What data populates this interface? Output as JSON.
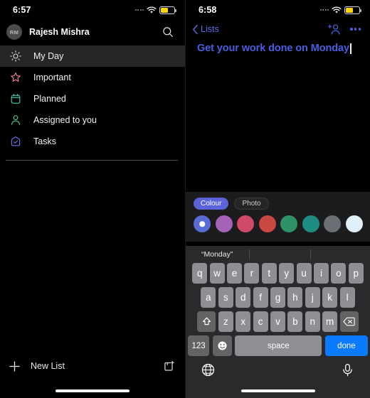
{
  "left": {
    "status": {
      "time": "6:57",
      "battery_color": "#ffd60a",
      "wifi_icon": "wifi-icon"
    },
    "account": {
      "initials": "RM",
      "name": "Rajesh Mishra",
      "search_icon": "search-icon"
    },
    "nav_items": [
      {
        "label": "My Day",
        "icon": "sun-icon",
        "color": "#e6e6e6",
        "selected": true
      },
      {
        "label": "Important",
        "icon": "star-icon",
        "color": "#f08098",
        "selected": false
      },
      {
        "label": "Planned",
        "icon": "calendar-icon",
        "color": "#4ec9b0",
        "selected": false
      },
      {
        "label": "Assigned to you",
        "icon": "person-icon",
        "color": "#4ec98a",
        "selected": false
      },
      {
        "label": "Tasks",
        "icon": "tasks-home-icon",
        "color": "#6a72e8",
        "selected": false
      }
    ],
    "footer": {
      "new_list_label": "New List",
      "plus_icon": "plus-icon",
      "new_group_icon": "new-group-icon"
    }
  },
  "right": {
    "status": {
      "time": "6:58",
      "battery_color": "#ffd60a",
      "wifi_icon": "wifi-icon"
    },
    "navbar": {
      "back_label": "Lists",
      "back_icon": "chevron-left-icon",
      "add_person_icon": "add-person-icon",
      "more_icon": "more-options-icon",
      "accent": "#4a5fe0"
    },
    "list_title": {
      "value": "Get your work done on Monday",
      "color": "#4a5fe0"
    },
    "picker": {
      "tabs": [
        {
          "label": "Colour",
          "active": true
        },
        {
          "label": "Photo",
          "active": false
        }
      ],
      "swatches": [
        {
          "name": "blue",
          "hex": "#5b6bd6",
          "selected": true
        },
        {
          "name": "purple",
          "hex": "#a563b8",
          "selected": false
        },
        {
          "name": "pink",
          "hex": "#cf4a68",
          "selected": false
        },
        {
          "name": "red",
          "hex": "#c9483f",
          "selected": false
        },
        {
          "name": "green",
          "hex": "#2e9266",
          "selected": false
        },
        {
          "name": "teal",
          "hex": "#1f8c84",
          "selected": false
        },
        {
          "name": "grey",
          "hex": "#6b7077",
          "selected": false
        },
        {
          "name": "light-blue",
          "hex": "#dff0fb",
          "selected": false
        }
      ]
    },
    "keyboard": {
      "prediction": "“Monday”",
      "row1": [
        "q",
        "w",
        "e",
        "r",
        "t",
        "y",
        "u",
        "i",
        "o",
        "p"
      ],
      "row2": [
        "a",
        "s",
        "d",
        "f",
        "g",
        "h",
        "j",
        "k",
        "l"
      ],
      "row3": [
        "z",
        "x",
        "c",
        "v",
        "b",
        "n",
        "m"
      ],
      "shift_icon": "shift-icon",
      "backspace_icon": "backspace-icon",
      "numbers_label": "123",
      "emoji_icon": "emoji-icon",
      "space_label": "space",
      "done_label": "done",
      "done_color": "#0a7bff",
      "globe_icon": "globe-icon",
      "mic_icon": "microphone-icon"
    }
  }
}
